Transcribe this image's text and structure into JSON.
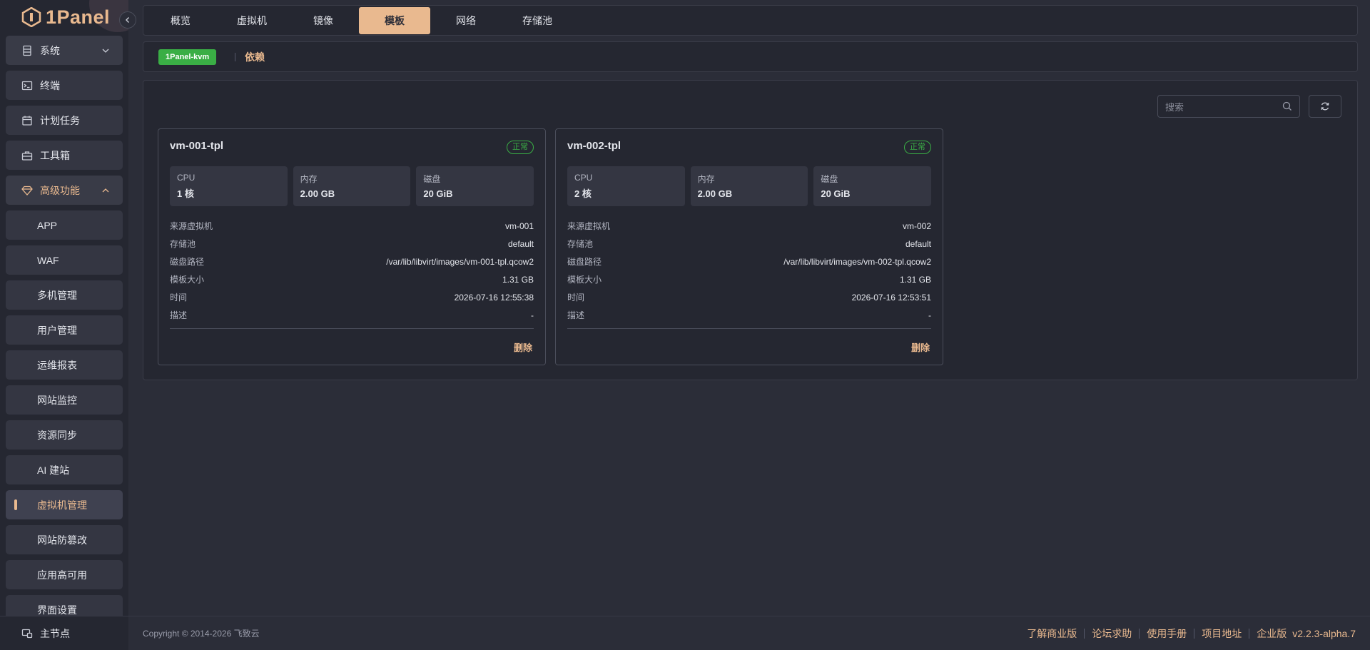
{
  "brand": {
    "name": "1Panel",
    "accent": "#e9b98f"
  },
  "sidebar": {
    "items": [
      {
        "label": "系统",
        "icon": "server-icon",
        "type": "group"
      },
      {
        "label": "终端",
        "icon": "terminal-icon",
        "type": "item"
      },
      {
        "label": "计划任务",
        "icon": "calendar-icon",
        "type": "item"
      },
      {
        "label": "工具箱",
        "icon": "toolbox-icon",
        "type": "item"
      },
      {
        "label": "高级功能",
        "icon": "diamond-icon",
        "type": "group-open"
      },
      {
        "label": "APP",
        "type": "sub"
      },
      {
        "label": "WAF",
        "type": "sub"
      },
      {
        "label": "多机管理",
        "type": "sub"
      },
      {
        "label": "用户管理",
        "type": "sub"
      },
      {
        "label": "运维报表",
        "type": "sub"
      },
      {
        "label": "网站监控",
        "type": "sub"
      },
      {
        "label": "资源同步",
        "type": "sub"
      },
      {
        "label": "AI 建站",
        "type": "sub"
      },
      {
        "label": "虚拟机管理",
        "type": "sub-active"
      },
      {
        "label": "网站防篡改",
        "type": "sub"
      },
      {
        "label": "应用高可用",
        "type": "sub"
      },
      {
        "label": "界面设置",
        "type": "sub"
      }
    ],
    "main_node": "主节点"
  },
  "tabs": [
    {
      "label": "概览"
    },
    {
      "label": "虚拟机"
    },
    {
      "label": "镜像"
    },
    {
      "label": "模板",
      "active": true
    },
    {
      "label": "网络"
    },
    {
      "label": "存储池"
    }
  ],
  "subbar": {
    "app_badge": "1Panel-kvm",
    "dependency_link": "依赖"
  },
  "toolbar": {
    "search_placeholder": "搜索"
  },
  "cards": [
    {
      "name": "vm-001-tpl",
      "status": "正常",
      "stats": [
        {
          "label": "CPU",
          "value": "1 核"
        },
        {
          "label": "内存",
          "value": "2.00 GB"
        },
        {
          "label": "磁盘",
          "value": "20 GiB"
        }
      ],
      "rows": [
        {
          "key": "来源虚拟机",
          "value": "vm-001"
        },
        {
          "key": "存储池",
          "value": "default"
        },
        {
          "key": "磁盘路径",
          "value": "/var/lib/libvirt/images/vm-001-tpl.qcow2"
        },
        {
          "key": "模板大小",
          "value": "1.31 GB"
        },
        {
          "key": "时间",
          "value": "2026-07-16 12:55:38"
        },
        {
          "key": "描述",
          "value": "-"
        }
      ],
      "delete_label": "删除"
    },
    {
      "name": "vm-002-tpl",
      "status": "正常",
      "stats": [
        {
          "label": "CPU",
          "value": "2 核"
        },
        {
          "label": "内存",
          "value": "2.00 GB"
        },
        {
          "label": "磁盘",
          "value": "20 GiB"
        }
      ],
      "rows": [
        {
          "key": "来源虚拟机",
          "value": "vm-002"
        },
        {
          "key": "存储池",
          "value": "default"
        },
        {
          "key": "磁盘路径",
          "value": "/var/lib/libvirt/images/vm-002-tpl.qcow2"
        },
        {
          "key": "模板大小",
          "value": "1.31 GB"
        },
        {
          "key": "时间",
          "value": "2026-07-16 12:53:51"
        },
        {
          "key": "描述",
          "value": "-"
        }
      ],
      "delete_label": "删除"
    }
  ],
  "footer": {
    "copyright": "Copyright © 2014-2026 飞致云",
    "links": [
      "了解商业版",
      "论坛求助",
      "使用手册",
      "项目地址"
    ],
    "edition": "企业版",
    "version": "v2.2.3-alpha.7"
  }
}
